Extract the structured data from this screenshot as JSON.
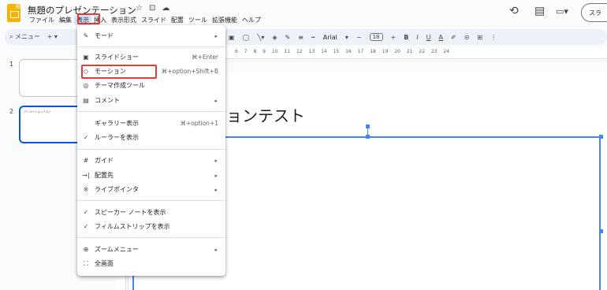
{
  "doc": {
    "title": "無題のプレゼンテーション"
  },
  "title_icons": [
    "☆",
    "⊡",
    "☁"
  ],
  "menubar": [
    "ファイル",
    "編集",
    "表示",
    "挿入",
    "表示形式",
    "スライド",
    "配置",
    "ツール",
    "拡張機能",
    "ヘルプ"
  ],
  "header_right": {
    "history_icon": "⟲",
    "comment_icon": "▤",
    "camera_icon": "▭▾",
    "slideshow_label": "スラ"
  },
  "toolbar": {
    "search_label": "メニュー",
    "add": "+",
    "font": "Arial",
    "font_size": "18",
    "minus": "−",
    "plus": "+"
  },
  "ruler_numbers": "6 7 8 9 10 11 12 13 14 15 16 17 18 19 20 21 22 23 24",
  "thumbnails": [
    {
      "num": "1",
      "text": ""
    },
    {
      "num": "2",
      "text": "アニメーションテスト"
    }
  ],
  "slide": {
    "title": "ョンテスト"
  },
  "menu": {
    "items": [
      {
        "icon": "✎",
        "label": "モード",
        "shortcut": "",
        "arrow": "▸"
      },
      {
        "icon": "▣",
        "label": "スライドショー",
        "shortcut": "⌘+Enter",
        "arrow": ""
      },
      {
        "icon": "◇",
        "label": "モーション",
        "shortcut": "⌘+option+Shift+B",
        "arrow": ""
      },
      {
        "icon": "◎",
        "label": "テーマ作成ツール",
        "shortcut": "",
        "arrow": ""
      },
      {
        "icon": "▤",
        "label": "コメント",
        "shortcut": "",
        "arrow": "▸"
      },
      {
        "icon": "",
        "label": "ギャラリー表示",
        "shortcut": "⌘+option+1",
        "arrow": ""
      },
      {
        "icon": "✓",
        "label": "ルーラーを表示",
        "shortcut": "",
        "arrow": ""
      },
      {
        "icon": "#",
        "label": "ガイド",
        "shortcut": "",
        "arrow": "▸"
      },
      {
        "icon": "→|",
        "label": "配置先",
        "shortcut": "",
        "arrow": "▸"
      },
      {
        "icon": "※",
        "label": "ライブポインタ",
        "shortcut": "",
        "arrow": "▸"
      },
      {
        "icon": "✓",
        "label": "スピーカー ノートを表示",
        "shortcut": "",
        "arrow": ""
      },
      {
        "icon": "✓",
        "label": "フィルムストリップを表示",
        "shortcut": "",
        "arrow": ""
      },
      {
        "icon": "⊕",
        "label": "ズームメニュー",
        "shortcut": "",
        "arrow": "▸"
      },
      {
        "icon": "⛶",
        "label": "全画面",
        "shortcut": "",
        "arrow": ""
      }
    ]
  }
}
